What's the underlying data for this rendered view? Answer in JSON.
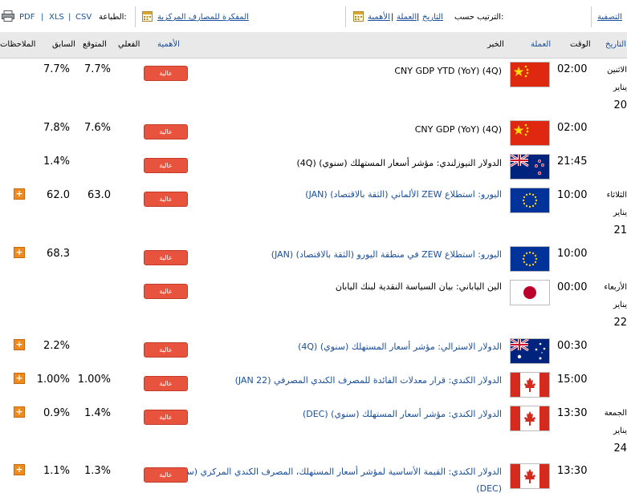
{
  "toolbar": {
    "filter_label": "التصفية",
    "sort_by_label": "الترتيب حسب:",
    "sort_options": [
      "التاريخ",
      "العملة",
      "الأهمية"
    ],
    "central_bank_label": "المفكرة للمصارف المركزية",
    "print_label": "الطباعة:",
    "formats": [
      "CSV",
      "XLS",
      "PDF"
    ]
  },
  "columns": {
    "date": "التاريخ",
    "time": "الوقت",
    "currency": "العملة",
    "event": "الخبر",
    "importance": "الأهمية",
    "actual": "الفعلي",
    "forecast": "المتوقع",
    "previous": "السابق",
    "notes": "الملاحظات"
  },
  "days": [
    {
      "day": "الاثنين",
      "month": "يناير",
      "date": "20"
    },
    {
      "day": "الثلاثاء",
      "month": "يناير",
      "date": "21"
    },
    {
      "day": "الأربعاء",
      "month": "يناير",
      "date": "22"
    },
    {
      "day": "الجمعة",
      "month": "يناير",
      "date": "24"
    }
  ],
  "events": [
    {
      "time": "02:00",
      "flag": "china-flag-icon",
      "title": "(CNY GDP YTD (YoY) (4Q",
      "importance": "عالية",
      "actual": "",
      "forecast": "7.7%",
      "previous": "7.7%",
      "link": false,
      "plus": false
    },
    {
      "time": "02:00",
      "flag": "china-flag-icon",
      "title": "(CNY GDP (YoY) (4Q",
      "importance": "عالية",
      "actual": "",
      "forecast": "7.6%",
      "previous": "7.8%",
      "link": false,
      "plus": false
    },
    {
      "time": "21:45",
      "flag": "new-zealand-flag-icon",
      "title": "الدولار النيوزلندي: مؤشر أسعار المستهلك (سنوي) (4Q)",
      "importance": "عالية",
      "actual": "",
      "forecast": "",
      "previous": "1.4%",
      "link": false,
      "plus": false
    },
    {
      "time": "10:00",
      "flag": "eu-flag-icon",
      "title": "اليورو: استطلاع ZEW الألماني (الثقة بالاقتصاد) (JAN)",
      "importance": "عالية",
      "actual": "",
      "forecast": "63.0",
      "previous": "62.0",
      "link": true,
      "plus": true
    },
    {
      "time": "10:00",
      "flag": "eu-flag-icon",
      "title": "اليورو: استطلاع ZEW في منطقة اليورو (الثقة بالاقتصاد) (JAN)",
      "importance": "عالية",
      "actual": "",
      "forecast": "",
      "previous": "68.3",
      "link": true,
      "plus": true
    },
    {
      "time": "00:00",
      "flag": "japan-flag-icon",
      "title": "الين الياباني: بيان السياسة النقدية لبنك اليابان",
      "importance": "عالية",
      "actual": "",
      "forecast": "",
      "previous": "",
      "link": false,
      "plus": false
    },
    {
      "time": "00:30",
      "flag": "australia-flag-icon",
      "title": "الدولار الاسترالي: مؤشر أسعار المستهلك (سنوي) (4Q)",
      "importance": "عالية",
      "actual": "",
      "forecast": "",
      "previous": "2.2%",
      "link": true,
      "plus": true
    },
    {
      "time": "15:00",
      "flag": "canada-flag-icon",
      "title": "الدولار الكندي: قرار معدلات الفائدة للمصرف الكندي المصرفي (JAN 22)",
      "importance": "عالية",
      "actual": "",
      "forecast": "1.00%",
      "previous": "1.00%",
      "link": true,
      "plus": true
    },
    {
      "time": "13:30",
      "flag": "canada-flag-icon",
      "title": "الدولار الكندي: مؤشر أسعار المستهلك (سنوي) (DEC)",
      "importance": "عالية",
      "actual": "",
      "forecast": "1.4%",
      "previous": "0.9%",
      "link": true,
      "plus": true
    },
    {
      "time": "13:30",
      "flag": "canada-flag-icon",
      "title": "الدولار الكندي: القيمة الأساسية لمؤشر أسعار المستهلك، المصرف الكندي المركزي (سنوي) (DEC)",
      "importance": "عالية",
      "actual": "",
      "forecast": "1.3%",
      "previous": "1.1%",
      "link": true,
      "plus": true
    }
  ]
}
